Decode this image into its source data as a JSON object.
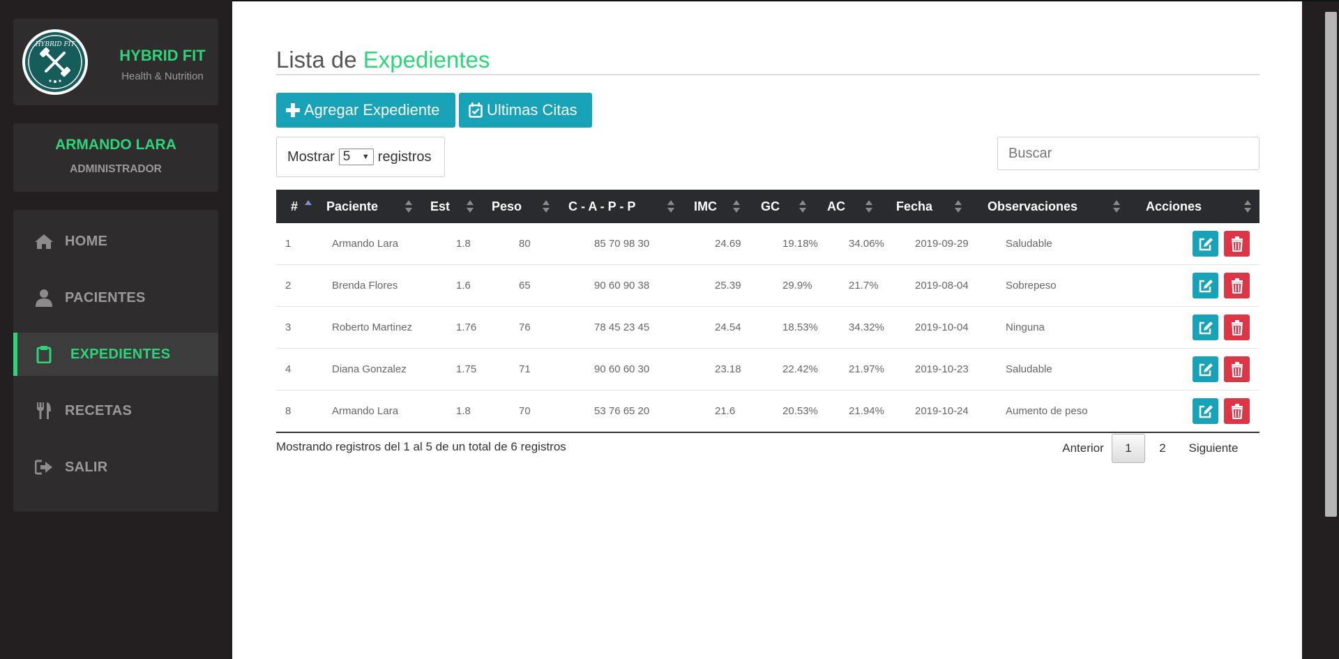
{
  "brand": {
    "title": "HYBRID FIT",
    "subtitle": "Health & Nutrition",
    "logo_text": "HYBRID FIT"
  },
  "user": {
    "name": "ARMANDO LARA",
    "role": "ADMINISTRADOR"
  },
  "nav": [
    {
      "label": "HOME",
      "icon": "home-icon",
      "active": false
    },
    {
      "label": "PACIENTES",
      "icon": "user-icon",
      "active": false
    },
    {
      "label": "EXPEDIENTES",
      "icon": "clipboard-icon",
      "active": true
    },
    {
      "label": "RECETAS",
      "icon": "utensils-icon",
      "active": false
    },
    {
      "label": "SALIR",
      "icon": "sign-out-icon",
      "active": false
    }
  ],
  "page": {
    "title_prefix": "Lista de",
    "title_accent": "Expedientes"
  },
  "toolbar": {
    "add_label": "Agregar Expediente",
    "citas_label": "Ultimas Citas"
  },
  "length": {
    "prefix": "Mostrar",
    "value": "5",
    "suffix": "registros"
  },
  "search": {
    "placeholder": "Buscar"
  },
  "table": {
    "columns": [
      "#",
      "Paciente",
      "Est",
      "Peso",
      "C - A - P - P",
      "IMC",
      "GC",
      "AC",
      "Fecha",
      "Observaciones",
      "Acciones"
    ],
    "rows": [
      [
        "1",
        "Armando Lara",
        "1.8",
        "80",
        "85 70 98 30",
        "24.69",
        "19.18%",
        "34.06%",
        "2019-09-29",
        "Saludable"
      ],
      [
        "2",
        "Brenda Flores",
        "1.6",
        "65",
        "90 60 90 38",
        "25.39",
        "29.9%",
        "21.7%",
        "2019-08-04",
        "Sobrepeso"
      ],
      [
        "3",
        "Roberto Martinez",
        "1.76",
        "76",
        "78 45 23 45",
        "24.54",
        "18.53%",
        "34.32%",
        "2019-10-04",
        "Ninguna"
      ],
      [
        "4",
        "Diana Gonzalez",
        "1.75",
        "71",
        "90 60 60 30",
        "23.18",
        "22.42%",
        "21.97%",
        "2019-10-23",
        "Saludable"
      ],
      [
        "8",
        "Armando Lara",
        "1.8",
        "70",
        "53 76 65 20",
        "21.6",
        "20.53%",
        "21.94%",
        "2019-10-24",
        "Aumento de peso"
      ]
    ]
  },
  "footer": {
    "info": "Mostrando registros del 1 al 5 de un total de 6 registros",
    "prev": "Anterior",
    "pages": [
      "1",
      "2"
    ],
    "current_page": "1",
    "next": "Siguiente"
  },
  "colors": {
    "accent": "#2ed47a",
    "primary": "#17a2b8",
    "danger": "#dc3545",
    "sidebar_bg": "#231f20",
    "table_head": "#2a2b2e"
  }
}
